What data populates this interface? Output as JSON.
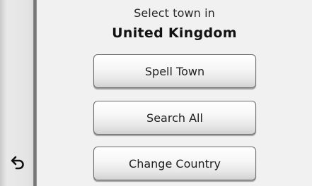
{
  "header": {
    "line1": "Select town in",
    "country": "United Kingdom"
  },
  "menu": {
    "spell_town": "Spell Town",
    "search_all": "Search All",
    "change_country": "Change Country"
  },
  "sidebar": {
    "back_icon": "back-arrow-icon"
  },
  "colors": {
    "background": "#f1f1f1",
    "button_border": "#6a6a6a",
    "text": "#1e1e1e"
  }
}
